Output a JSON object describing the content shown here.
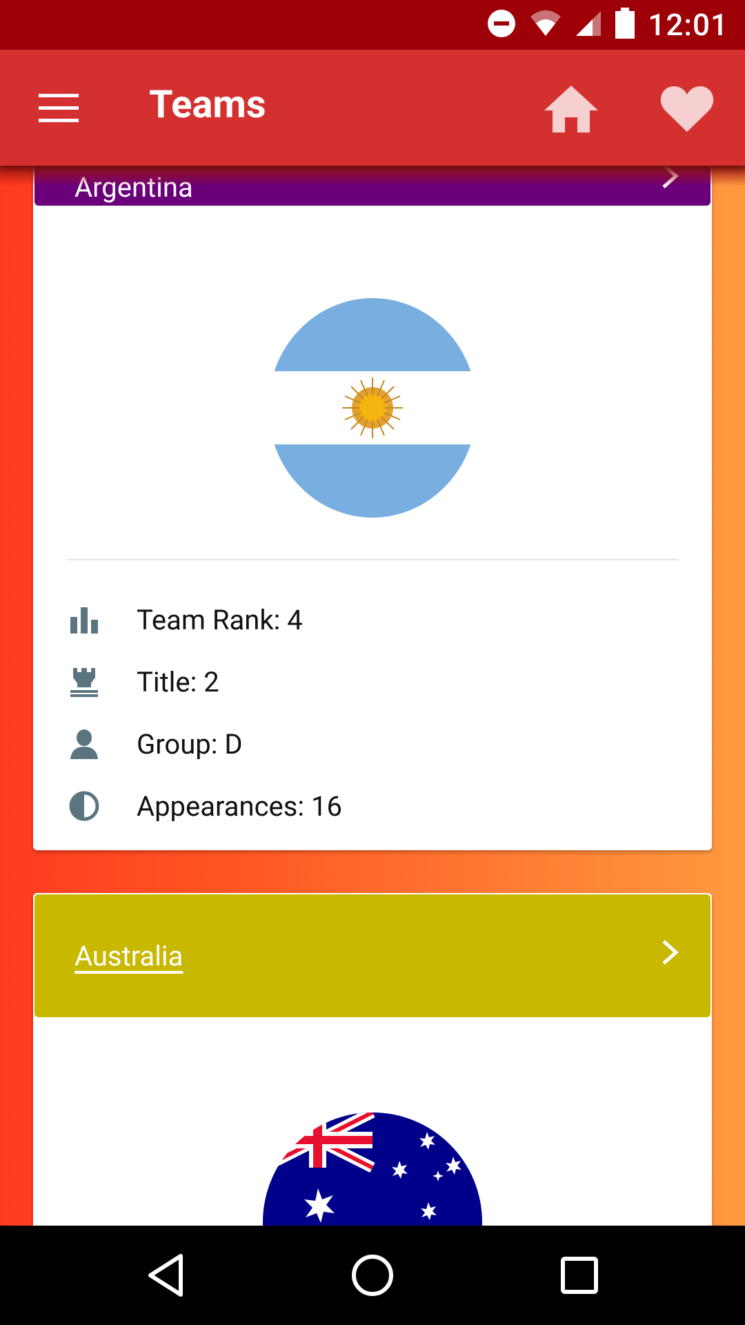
{
  "status": {
    "time": "12:01"
  },
  "appbar": {
    "title": "Teams"
  },
  "teams": [
    {
      "name": "Argentina",
      "header_color": "#6a007a",
      "stats": {
        "rank": "Team Rank: 4",
        "title": "Title: 2",
        "group": "Group: D",
        "appearances": "Appearances: 16"
      }
    },
    {
      "name": "Australia",
      "header_color": "#c8b800"
    }
  ],
  "colors": {
    "statusbar": "#9e0008",
    "appbar": "#d43030",
    "icon_grey": "#5b7480"
  }
}
